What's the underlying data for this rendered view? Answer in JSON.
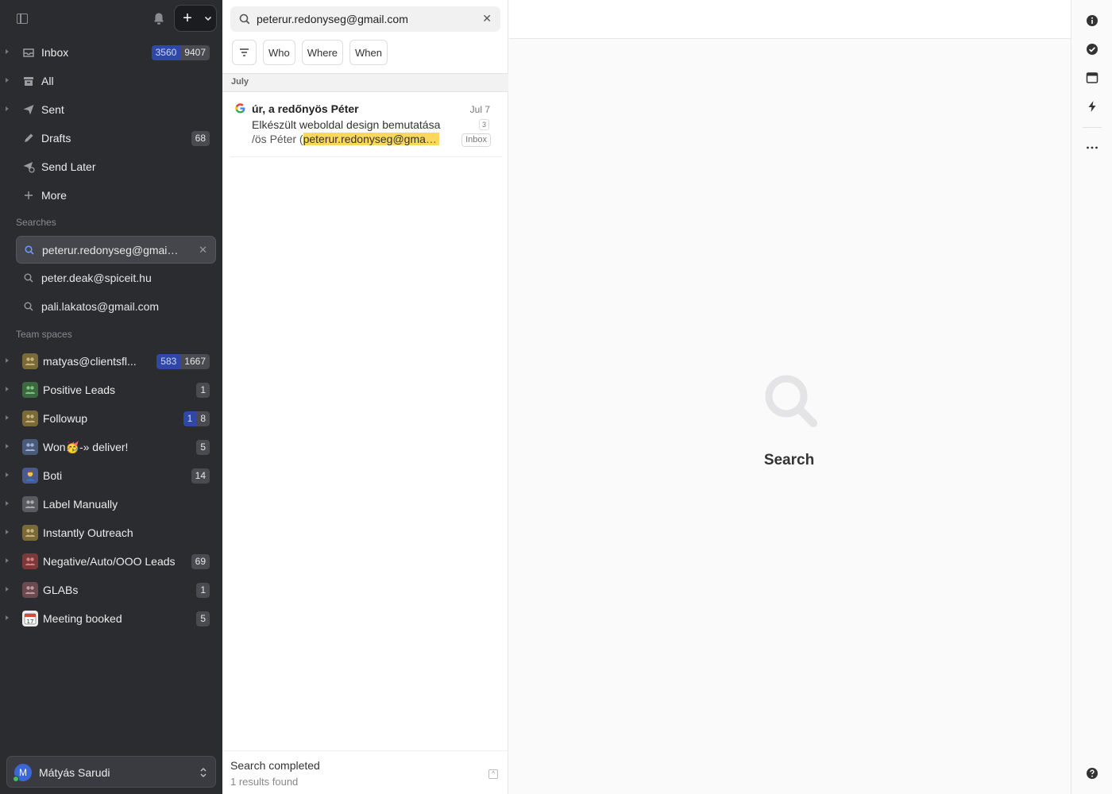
{
  "nav": {
    "inbox": {
      "label": "Inbox",
      "unread": "3560",
      "total": "9407"
    },
    "all": {
      "label": "All"
    },
    "sent": {
      "label": "Sent"
    },
    "drafts": {
      "label": "Drafts",
      "count": "68"
    },
    "send_later": {
      "label": "Send Later"
    },
    "more": {
      "label": "More"
    }
  },
  "searches": {
    "header": "Searches",
    "items": [
      {
        "label": "peterur.redonyseg@gmail.com"
      },
      {
        "label": "peter.deak@spiceit.hu"
      },
      {
        "label": "pali.lakatos@gmail.com"
      }
    ]
  },
  "teams": {
    "header": "Team spaces",
    "items": [
      {
        "label": "matyas@clientsfl...",
        "unread": "583",
        "total": "1667",
        "color": "#7a6a3a"
      },
      {
        "label": "Positive Leads",
        "count": "1",
        "color": "#3a6a3e"
      },
      {
        "label": "Followup",
        "unread": "1",
        "total": "8",
        "color": "#7a6a3a"
      },
      {
        "label": "Won🥳-» deliver!",
        "count": "5",
        "color": "#4a5a7a"
      },
      {
        "label": "Boti",
        "count": "14",
        "color": "#4a5a8a"
      },
      {
        "label": "Label Manually",
        "count": "",
        "color": "#5a5b60"
      },
      {
        "label": "Instantly Outreach",
        "count": "",
        "color": "#7a6a3a"
      },
      {
        "label": "Negative/Auto/OOO Leads",
        "count": "69",
        "color": "#7a3a3a"
      },
      {
        "label": "GLABs",
        "count": "1",
        "color": "#6a4a4e"
      },
      {
        "label": "Meeting booked",
        "count": "5",
        "color": "#d44a3a"
      }
    ]
  },
  "user": {
    "initial": "M",
    "name": "Mátyás Sarudi"
  },
  "search": {
    "query": "peterur.redonyseg@gmail.com"
  },
  "filters": {
    "who": "Who",
    "where": "Where",
    "when": "When"
  },
  "results": {
    "month": "July",
    "messages": [
      {
        "sender": "úr, a redőnyös Péter",
        "date": "Jul 7",
        "subject": "Elkészült weboldal design bemutatása",
        "thread_count": "3",
        "snippet_prefix": "/ös Péter (",
        "snippet_highlight": "peterur.redonyseg@gmail.com",
        "tag": "Inbox"
      }
    ],
    "status": "Search completed",
    "count_text": "1 results found"
  },
  "main": {
    "empty_title": "Search"
  },
  "colors": {
    "sidebar_bg": "#2b2c30",
    "badge_blue": "#2f48a8",
    "highlight": "#fbd75b"
  }
}
